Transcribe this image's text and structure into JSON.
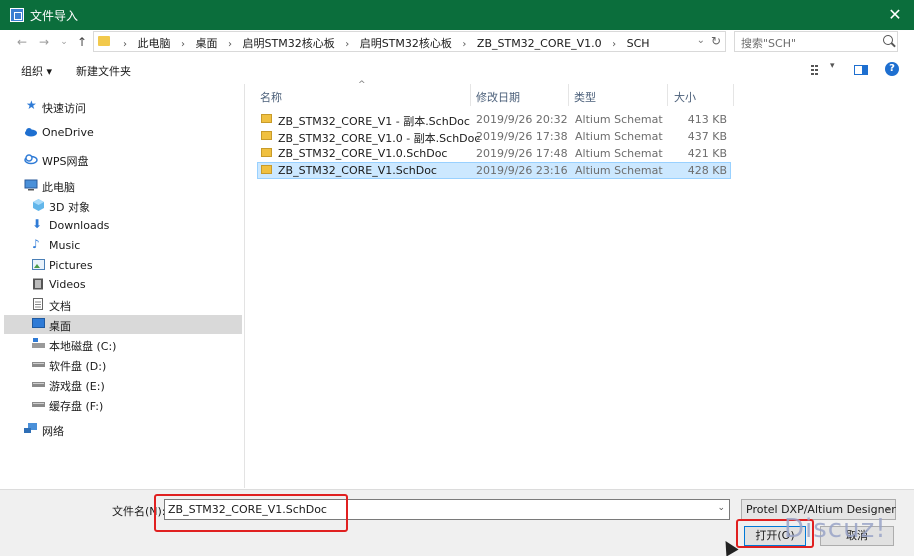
{
  "window": {
    "title": "文件导入",
    "close_glyph": "✕"
  },
  "address": {
    "crumbs": [
      "此电脑",
      "桌面",
      "启明STM32核心板",
      "启明STM32核心板",
      "ZB_STM32_CORE_V1.0",
      "SCH"
    ],
    "search_placeholder": "搜索\"SCH\""
  },
  "toolbar": {
    "organize": "组织 ▾",
    "new_folder": "新建文件夹"
  },
  "sidebar": {
    "items": [
      {
        "label": "快速访问",
        "icon": "star-icon"
      },
      {
        "label": "OneDrive",
        "icon": "cloud-icon"
      },
      {
        "label": "WPS网盘",
        "icon": "cloud-outline-icon"
      },
      {
        "label": "此电脑",
        "icon": "computer-icon"
      },
      {
        "label": "3D 对象",
        "icon": "cube-icon"
      },
      {
        "label": "Downloads",
        "icon": "download-icon"
      },
      {
        "label": "Music",
        "icon": "music-icon"
      },
      {
        "label": "Pictures",
        "icon": "pictures-icon"
      },
      {
        "label": "Videos",
        "icon": "video-icon"
      },
      {
        "label": "文档",
        "icon": "document-icon"
      },
      {
        "label": "桌面",
        "icon": "desktop-icon"
      },
      {
        "label": "本地磁盘 (C:)",
        "icon": "drive-icon"
      },
      {
        "label": "软件盘 (D:)",
        "icon": "drive-icon"
      },
      {
        "label": "游戏盘 (E:)",
        "icon": "drive-icon"
      },
      {
        "label": "缓存盘 (F:)",
        "icon": "drive-icon"
      },
      {
        "label": "网络",
        "icon": "network-icon"
      }
    ],
    "selected": "桌面"
  },
  "columns": {
    "name": "名称",
    "date": "修改日期",
    "type": "类型",
    "size": "大小"
  },
  "files": [
    {
      "name": "ZB_STM32_CORE_V1 - 副本.SchDoc",
      "date": "2019/9/26 20:32",
      "type": "Altium Schematic...",
      "size": "413 KB"
    },
    {
      "name": "ZB_STM32_CORE_V1.0 - 副本.SchDoc",
      "date": "2019/9/26 17:38",
      "type": "Altium Schematic...",
      "size": "437 KB"
    },
    {
      "name": "ZB_STM32_CORE_V1.0.SchDoc",
      "date": "2019/9/26 17:48",
      "type": "Altium Schematic...",
      "size": "421 KB"
    },
    {
      "name": "ZB_STM32_CORE_V1.SchDoc",
      "date": "2019/9/26 23:16",
      "type": "Altium Schematic...",
      "size": "428 KB",
      "selected": true
    }
  ],
  "bottom": {
    "filename_label": "文件名(N):",
    "filename_value": "ZB_STM32_CORE_V1.SchDoc",
    "filter_value": "Protel DXP/Altium Designer",
    "open_label": "打开(O)",
    "cancel_label": "取消"
  },
  "watermark": "Discuz!",
  "colors": {
    "titlebar": "#0b6e3c",
    "selection": "#cce8ff",
    "highlight": "#e02020"
  }
}
